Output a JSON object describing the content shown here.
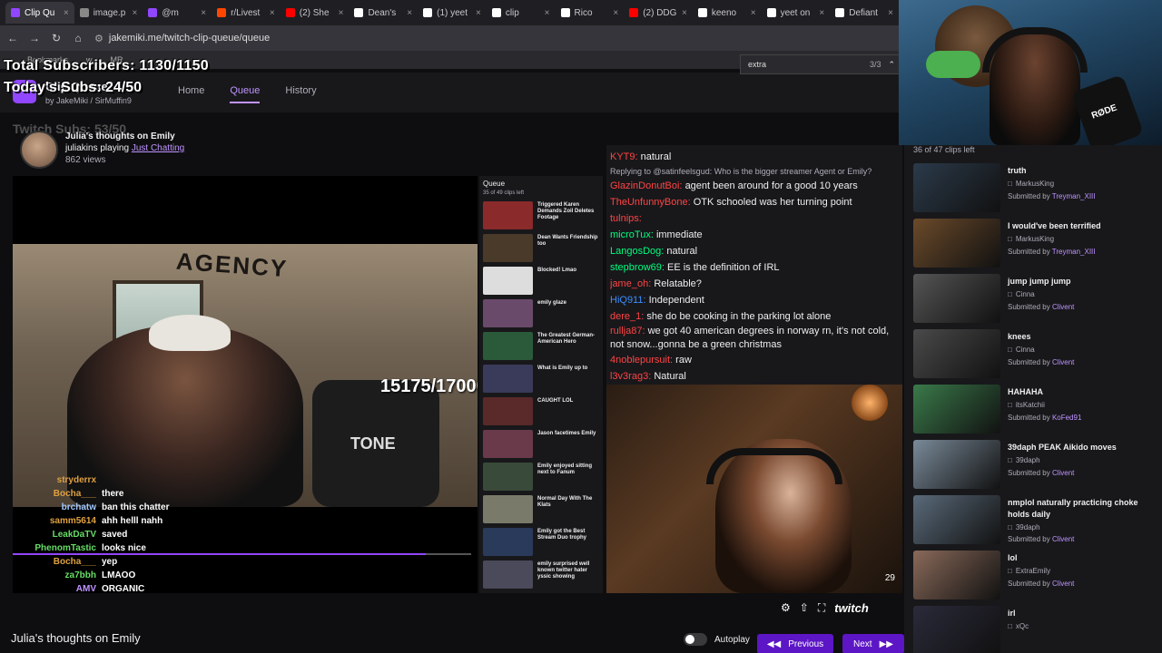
{
  "browser": {
    "tabs": [
      {
        "label": "Clip Qu",
        "color": "#9146ff",
        "active": true
      },
      {
        "label": "image.p",
        "color": "#888888"
      },
      {
        "label": "@m",
        "color": "#9146ff"
      },
      {
        "label": "r/Livest",
        "color": "#ff4500"
      },
      {
        "label": "(2) She",
        "color": "#ff0000"
      },
      {
        "label": "Dean's",
        "color": "#ffffff"
      },
      {
        "label": "(1) yeet",
        "color": "#ffffff"
      },
      {
        "label": "clip",
        "color": "#ffffff"
      },
      {
        "label": "Rico",
        "color": "#ffffff"
      },
      {
        "label": "(2) DDG",
        "color": "#ff0000"
      },
      {
        "label": "keeno",
        "color": "#ffffff"
      },
      {
        "label": "yeet on",
        "color": "#ffffff"
      },
      {
        "label": "Defiant",
        "color": "#ffffff"
      }
    ],
    "url": "jakemiki.me/twitch-clip-queue/queue",
    "bookmarks": [
      "Bookmarks",
      "w",
      "MR"
    ],
    "find": {
      "query": "extra",
      "count": "3/3"
    }
  },
  "overlay": {
    "total_subs": "Total Subscribers: 1130/1150",
    "today_subs": "Today's Subs: 24/50",
    "twitch_subs": "Twitch Subs: 53/50"
  },
  "site": {
    "title": "Clip Queue",
    "by": "by",
    "author1": "JakeMiki",
    "author2": "SirMuffin9",
    "nav": [
      "Home",
      "Queue",
      "History"
    ]
  },
  "clip": {
    "title": "Julia's thoughts on Emily",
    "channel": "juliakins",
    "playing": "playing",
    "game": "Just Chatting",
    "views": "862 views",
    "bottom_title": "Julia's thoughts on Emily"
  },
  "video": {
    "subgoal": "15175/17000",
    "chat": [
      {
        "user": "stryderrx",
        "msg": "",
        "color": "#e0a040"
      },
      {
        "user": "Bocha___",
        "msg": "there",
        "color": "#e0a040"
      },
      {
        "user": "brchatw",
        "msg": "ban this chatter",
        "color": "#a0c8ff"
      },
      {
        "user": "samm5614",
        "msg": "ahh helll nahh",
        "color": "#e0a040"
      },
      {
        "user": "LeakDaTV",
        "msg": "saved",
        "color": "#66dd66"
      },
      {
        "user": "PhenomTastic",
        "msg": "looks nice",
        "color": "#66dd66"
      },
      {
        "user": "Bocha___",
        "msg": "yep",
        "color": "#e0a040"
      },
      {
        "user": "za7bbh",
        "msg": "LMAOO",
        "color": "#66dd66"
      },
      {
        "user": "AMV",
        "msg": "ORGANIC",
        "color": "#bf94ff"
      },
      {
        "user": "ImagineLatinas",
        "msg": "",
        "color": "#ff5555"
      },
      {
        "user": "TheBixar",
        "msg": "it fits her more",
        "color": "#bf94ff"
      },
      {
        "user": "theblackdog",
        "msg": "Indeed",
        "color": "#ff5555"
      },
      {
        "user": "Andruisthegamer",
        "msg": "",
        "color": "#e0a040"
      }
    ],
    "inner_queue": {
      "title": "Queue",
      "count": "35 of 49 clips left",
      "items": [
        "Triggered Karen Demands Zoil Deletes Footage",
        "Dean Wants Friendship too",
        "Blocked! Lmao",
        "emily glaze",
        "The Greatest German-American Hero",
        "What is Emily up to",
        "CAUGHT LOL",
        "Jason facetimes Emily",
        "Emily enjoyed sitting next to Fanum",
        "Normal Day With The Klats",
        "Emily got the Best Stream Duo trophy",
        "emily surprised well known twitter hater yssic showing"
      ]
    },
    "cam_number": "29"
  },
  "twitch_chat": {
    "reply": "Replying to @satinfeelsgud: Who is the bigger streamer Agent or Emily?",
    "lines": [
      {
        "user": "KYT9:",
        "msg": "natural",
        "color": "#ff4444"
      },
      {
        "user": "GlazinDonutBoi:",
        "msg": "agent been around for a good 10 years",
        "color": "#ff4444"
      },
      {
        "user": "TheUnfunnyBone:",
        "msg": "OTK schooled was her turning point",
        "color": "#ff4444"
      },
      {
        "user": "tulnips:",
        "msg": "",
        "color": "#ff4444"
      },
      {
        "user": "microTux:",
        "msg": "immediate",
        "color": "#00ff7f"
      },
      {
        "user": "LangosDog:",
        "msg": "natural",
        "color": "#00ff7f"
      },
      {
        "user": "stepbrow69:",
        "msg": "EE is the definition of IRL",
        "color": "#00ff7f"
      },
      {
        "user": "jame_oh:",
        "msg": "Relatable?",
        "color": "#ff4444"
      },
      {
        "user": "HiQ911:",
        "msg": "Independent",
        "color": "#3c8fff"
      },
      {
        "user": "dere_1:",
        "msg": "she do be cooking in the parking lot alone",
        "color": "#ff4444"
      },
      {
        "user": "rullja87:",
        "msg": "we got 40 american degrees in norway rn, it's not cold, not snow...gonna be a green christmas",
        "color": "#ff4444"
      },
      {
        "user": "4noblepursuit:",
        "msg": "raw",
        "color": "#ff4444"
      },
      {
        "user": "l3v3rag3:",
        "msg": "Natural",
        "color": "#ff4444"
      }
    ]
  },
  "controls": {
    "autoplay": "Autoplay",
    "previous": "Previous",
    "next": "Next",
    "twitch": "twitch"
  },
  "sidebar": {
    "count": "36 of 47 clips left",
    "submitted_by": "Submitted by",
    "items": [
      {
        "title": "truth",
        "creator": "MarkusKing",
        "submitter": "Treyman_XIII",
        "thumb": "#2b3a4a"
      },
      {
        "title": "I would've been terrified",
        "creator": "MarkusKing",
        "submitter": "Treyman_XIII",
        "thumb": "#6b4a2a"
      },
      {
        "title": "jump jump jump",
        "creator": "Cinna",
        "submitter": "Clivent",
        "thumb": "#555555"
      },
      {
        "title": "knees",
        "creator": "Cinna",
        "submitter": "Clivent",
        "thumb": "#4a4a4a"
      },
      {
        "title": "HAHAHA",
        "creator": "itsKatchii",
        "submitter": "KoFed91",
        "thumb": "#3a7a4a"
      },
      {
        "title": "39daph PEAK Aikido moves",
        "creator": "39daph",
        "submitter": "Clivent",
        "thumb": "#7a8a99"
      },
      {
        "title": "nmplol naturally practicing choke holds daily",
        "creator": "39daph",
        "submitter": "Clivent",
        "thumb": "#5a6a7a"
      },
      {
        "title": "lol",
        "creator": "ExtraEmily",
        "submitter": "Clivent",
        "thumb": "#8a6a5a"
      },
      {
        "title": "irl",
        "creator": "xQc",
        "submitter": "",
        "thumb": "#2a2a3a"
      }
    ]
  },
  "webcam": {
    "mic_brand": "RØDE"
  }
}
